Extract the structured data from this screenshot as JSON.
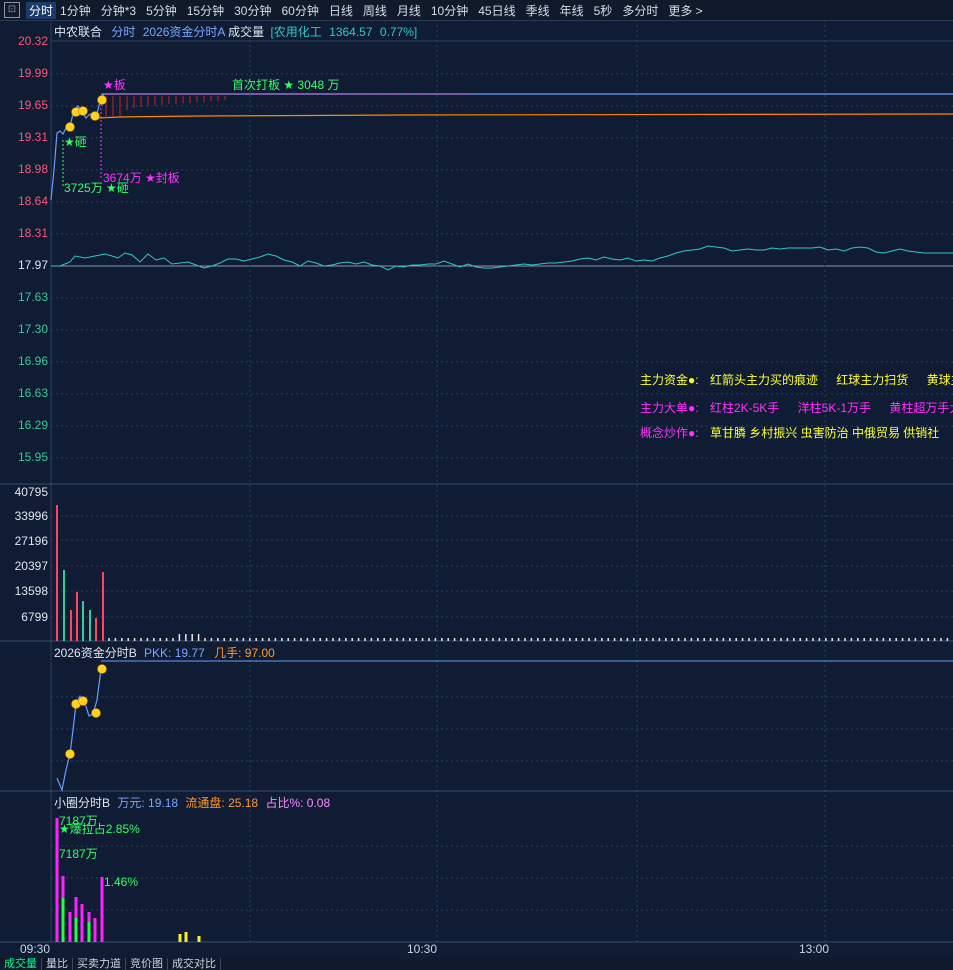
{
  "toolbar": {
    "icon": "collapse-icon",
    "tabs": [
      "分时",
      "1分钟",
      "分钟*3",
      "5分钟",
      "15分钟",
      "30分钟",
      "60分钟",
      "日线",
      "周线",
      "月线",
      "10分钟",
      "45日线",
      "季线",
      "年线",
      "5秒",
      "多分时",
      "更多 >"
    ],
    "active": "分时"
  },
  "main_chart": {
    "stock_name": "中农联合",
    "indicator_label": "分时",
    "formula_label": "2026资金分时A",
    "volume_label": "成交量",
    "sector_label": "[农用化工",
    "sector_value": "1364.57",
    "sector_change": "0.77%]",
    "y_ticks": [
      "20.32",
      "19.99",
      "19.65",
      "19.31",
      "18.98",
      "18.64",
      "18.31",
      "17.97",
      "17.63",
      "17.30",
      "16.96",
      "16.63",
      "16.29",
      "15.95"
    ],
    "annotations": {
      "board": "★板",
      "first_board": "首次打板 ★ 3048 万",
      "smash1": "★砸",
      "seal": "3674万 ★封板",
      "smash2": "3725万 ★砸"
    },
    "legend_rows": [
      {
        "label": "主力资金●:",
        "items": [
          "红箭头主力买的痕迹",
          "红球主力扫货",
          "黄球主"
        ]
      },
      {
        "label": "主力大单●:",
        "items": [
          "红柱2K-5K手",
          "洋柱5K-1万手",
          "黄柱超万手大"
        ]
      },
      {
        "label": "概念炒作●:",
        "items": [
          "草甘膦 乡村振兴 虫害防治 中俄贸易 供销社"
        ]
      }
    ],
    "colors": {
      "label_yellow": "#ffff33",
      "label_magenta": "#ff33ff",
      "price_line": "#6a9dff",
      "avg_line": "#ff8800",
      "sector_line": "#30c8c8",
      "grid": "#2b3f5e"
    }
  },
  "volume_chart": {
    "y_ticks": [
      "40795",
      "33996",
      "27196",
      "20397",
      "13598",
      "6799"
    ]
  },
  "pkk_chart": {
    "title": "2026资金分时B",
    "pkk_label": "PKK: 19.77",
    "jishou_label": "几手: 97.00"
  },
  "circle_chart": {
    "title": "小圈分时B",
    "wanyuan_label": "万元: 19.18",
    "float_label": "流通盘: 25.18",
    "ratio_label": "占比%: 0.08",
    "annotations": {
      "top_value": "7187万",
      "burst": "★爆拉占2.85%",
      "second_value": "7187万",
      "pct": "1.46%"
    }
  },
  "x_axis": {
    "ticks": [
      "09:30",
      "10:30",
      "13:00"
    ]
  },
  "bottom_tabs": [
    "成交量",
    "量比",
    "买卖力道",
    "竞价图",
    "成交对比"
  ],
  "bottom_active": "成交量"
}
